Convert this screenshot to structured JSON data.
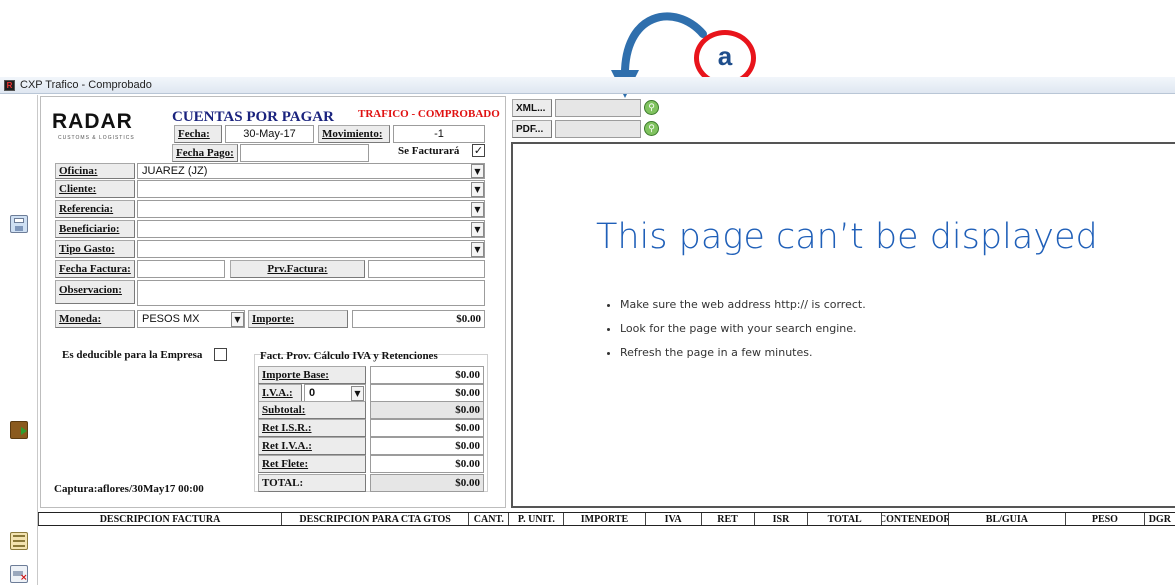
{
  "annotation": {
    "letter": "a"
  },
  "window": {
    "title": "CXP Trafico - Comprobado"
  },
  "header": {
    "logo": "RADAR",
    "logo_sub": "CUSTOMS & LOGISTICS",
    "title": "CUENTAS POR PAGAR",
    "subtitle": "TRAFICO - COMPROBADO"
  },
  "form": {
    "fecha_label": "Fecha:",
    "fecha_value": "30-May-17",
    "movimiento_label": "Movimiento:",
    "movimiento_value": "-1",
    "fecha_pago_label": "Fecha Pago:",
    "fecha_pago_value": "",
    "se_facturara_label": "Se Facturará",
    "se_facturara_mark": "✓",
    "oficina_label": "Oficina:",
    "oficina_value": "JUAREZ (JZ)",
    "cliente_label": "Cliente:",
    "referencia_label": "Referencia:",
    "beneficiario_label": "Beneficiario:",
    "tipo_gasto_label": "Tipo Gasto:",
    "fecha_factura_label": "Fecha Factura:",
    "prv_factura_label": "Prv.Factura:",
    "observacion_label": "Observacion:",
    "moneda_label": "Moneda:",
    "moneda_value": "PESOS MX",
    "importe_label": "Importe:",
    "importe_value": "$0.00",
    "deducible_label": "Es deducible para la Empresa",
    "captura": "Captura:aflores/30May17 00:00"
  },
  "calc": {
    "title": "Fact. Prov. Cálculo IVA y Retenciones",
    "importe_base_label": "Importe Base:",
    "importe_base_value": "$0.00",
    "iva_label": "I.V.A.:",
    "iva_rate": "0",
    "iva_value": "$0.00",
    "subtotal_label": "Subtotal:",
    "subtotal_value": "$0.00",
    "ret_isr_label": "Ret I.S.R.:",
    "ret_isr_value": "$0.00",
    "ret_iva_label": "Ret I.V.A.:",
    "ret_iva_value": "$0.00",
    "ret_flete_label": "Ret Flete:",
    "ret_flete_value": "$0.00",
    "total_label": "TOTAL:",
    "total_value": "$0.00"
  },
  "attachments": {
    "xml_label": "XML...",
    "pdf_label": "PDF..."
  },
  "browser": {
    "error_title": "This page can’t be displayed",
    "tips": [
      "Make sure the web address http:// is correct.",
      "Look for the page with your search engine.",
      "Refresh the page in a few minutes."
    ]
  },
  "table": {
    "columns": [
      "DESCRIPCION FACTURA",
      "DESCRIPCION PARA CTA GTOS",
      "CANT.",
      "P. UNIT.",
      "IMPORTE",
      "IVA",
      "RET",
      "ISR",
      "TOTAL",
      "CONTENEDOR",
      "BL/GUIA",
      "PESO",
      "DGR"
    ]
  },
  "colors": {
    "title_blue": "#1a237e",
    "alert_red": "#e01010",
    "link_blue": "#1f5fb8",
    "annotation_red": "#e8141b"
  }
}
